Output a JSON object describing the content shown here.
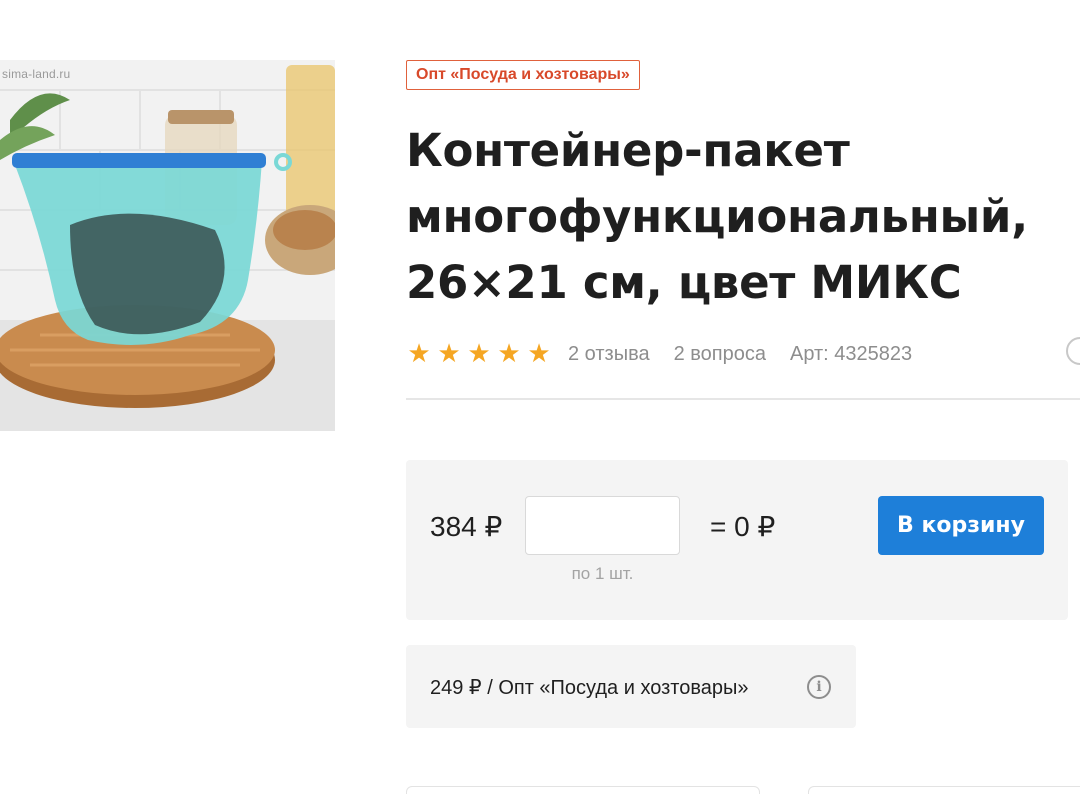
{
  "product": {
    "image_alt": "Контейнер-пакет",
    "watermark": "sima-land.ru",
    "badge": "Опт «Посуда и хозтовары»",
    "title": "Контейнер-пакет многофункциональный, 26×21 см, цвет МИКС",
    "rating": 5,
    "reviews": "2 отзыва",
    "questions": "2 вопроса",
    "article": "Арт: 4325823"
  },
  "purchase": {
    "price": "384 ₽",
    "quantity_value": "",
    "quantity_hint": "по 1 шт.",
    "total": "= 0 ₽",
    "cart_button": "В корзину"
  },
  "wholesale": {
    "text": "249 ₽ / Опт «Посуда и хозтовары»"
  },
  "colors": {
    "accent_blue": "#1e7fd9",
    "badge_red": "#d8492a",
    "star": "#f5a623"
  },
  "icons": {
    "star": "star-icon",
    "info": "info-icon",
    "favorite": "heart-icon"
  }
}
